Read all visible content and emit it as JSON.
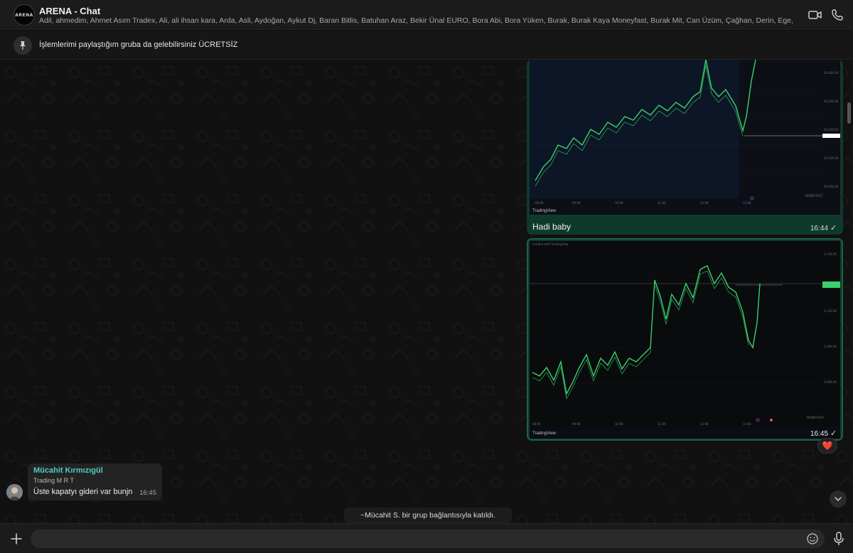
{
  "header": {
    "avatar_text": "ARENA",
    "title": "ARENA - Chat",
    "members": "Adil, ahmedim, Ahmet Asım Tradex, Ali, ali ihsan kara, Arda, Asli, Aydoğan, Aykut Dj, Baran Bitlis, Batuhan Araz, Bekir Ünal EURO, Bora Abi, Bora Yüken, Burak, Burak Kaya Moneyfast, Burak Mit, Can Üzüm, Çağhan, Derin, Ege, Emre Aydın,...",
    "video_icon": "video-camera-icon",
    "call_icon": "phone-icon"
  },
  "pinned": {
    "icon": "pin-icon",
    "text": "İşlemlerimi paylaştığım gruba da gelebilirsiniz ÜCRETSİZ"
  },
  "messages": {
    "image1": {
      "platform": "TradingView",
      "caption": "Hadi baby",
      "time": "16:44",
      "status": "✓"
    },
    "image2": {
      "platform": "TradingView",
      "time": "16:45",
      "status": "✓",
      "reaction": "❤️"
    },
    "text_message": {
      "sender": "Mücahit Kırmızıgül",
      "subtitle": "Trading M R T",
      "text": "Üste kapatyı gideri var bunjn",
      "time": "16:45"
    },
    "system": "~Mücahit S. bir grup bağlantısıyla katıldı."
  },
  "input": {
    "placeholder": "",
    "value": ""
  },
  "colors": {
    "accent_green": "#0e3a2c",
    "sender_name": "#4ecdc4",
    "candle_up": "#3bd16f",
    "reaction_heart": "#ff3b57"
  }
}
